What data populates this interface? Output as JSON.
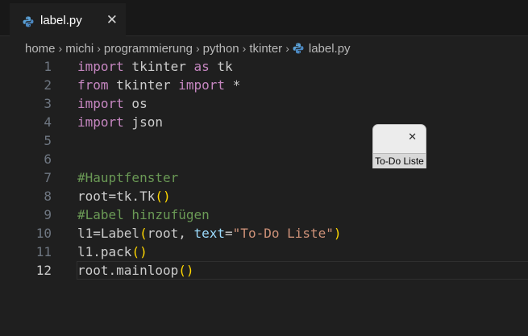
{
  "tab": {
    "title": "label.py",
    "close_glyph": "✕",
    "icon": "python-file-icon"
  },
  "breadcrumb": {
    "items": [
      "home",
      "michi",
      "programmierung",
      "python",
      "tkinter"
    ],
    "file": "label.py",
    "separator": "›"
  },
  "editor": {
    "current_line": 12,
    "lines": [
      {
        "n": "1",
        "tokens": [
          {
            "t": "import",
            "c": "kw"
          },
          {
            "t": " tkinter ",
            "c": ""
          },
          {
            "t": "as",
            "c": "kw"
          },
          {
            "t": " tk",
            "c": ""
          }
        ]
      },
      {
        "n": "2",
        "tokens": [
          {
            "t": "from",
            "c": "kw"
          },
          {
            "t": " tkinter ",
            "c": ""
          },
          {
            "t": "import",
            "c": "kw"
          },
          {
            "t": " *",
            "c": ""
          }
        ]
      },
      {
        "n": "3",
        "tokens": [
          {
            "t": "import",
            "c": "kw"
          },
          {
            "t": " os",
            "c": ""
          }
        ]
      },
      {
        "n": "4",
        "tokens": [
          {
            "t": "import",
            "c": "kw"
          },
          {
            "t": " json",
            "c": ""
          }
        ]
      },
      {
        "n": "5",
        "tokens": []
      },
      {
        "n": "6",
        "tokens": []
      },
      {
        "n": "7",
        "tokens": [
          {
            "t": "#Hauptfenster",
            "c": "cm"
          }
        ]
      },
      {
        "n": "8",
        "tokens": [
          {
            "t": "root=tk.Tk",
            "c": ""
          },
          {
            "t": "()",
            "c": "br"
          }
        ]
      },
      {
        "n": "9",
        "tokens": [
          {
            "t": "#Label hinzufügen",
            "c": "cm"
          }
        ]
      },
      {
        "n": "10",
        "tokens": [
          {
            "t": "l1=Label",
            "c": ""
          },
          {
            "t": "(",
            "c": "br"
          },
          {
            "t": "root, ",
            "c": ""
          },
          {
            "t": "text",
            "c": "pr"
          },
          {
            "t": "=",
            "c": ""
          },
          {
            "t": "\"To-Do Liste\"",
            "c": "st"
          },
          {
            "t": ")",
            "c": "br"
          }
        ]
      },
      {
        "n": "11",
        "tokens": [
          {
            "t": "l1.pack",
            "c": ""
          },
          {
            "t": "()",
            "c": "br"
          }
        ]
      },
      {
        "n": "12",
        "tokens": [
          {
            "t": "root.mainloop",
            "c": ""
          },
          {
            "t": "()",
            "c": "br"
          }
        ]
      }
    ]
  },
  "tk_window": {
    "close_glyph": "✕",
    "label_text": "To-Do Liste"
  },
  "colors": {
    "background": "#1f1f1f",
    "keyword": "#c586c0",
    "comment": "#6a9955",
    "bracket": "#ffd700",
    "string": "#ce9178",
    "parameter": "#9cdcfe",
    "text": "#cccccc"
  }
}
